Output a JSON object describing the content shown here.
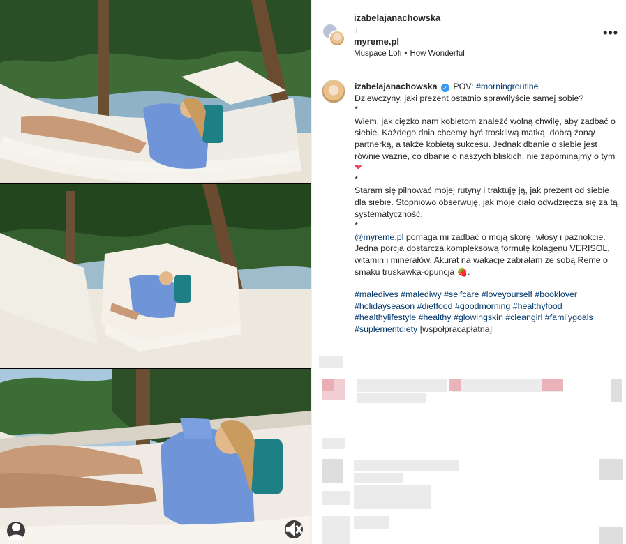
{
  "header": {
    "user1": "izabelajanachowska",
    "and": "i",
    "user2": "myreme.pl",
    "audio_artist": "Muspace Lofi",
    "audio_sep": "•",
    "audio_title": "How Wonderful",
    "more_label": "•••"
  },
  "caption": {
    "username": "izabelajanachowska",
    "verified_glyph": "✓",
    "lead": "POV: ",
    "lead_tag": "#morningroutine",
    "line1": "Dziewczyny, jaki prezent ostatnio sprawiłyście samej sobie?",
    "star1": "*",
    "para1": "Wiem, jak ciężko nam kobietom znaleźć wolną chwilę, aby zadbać o siebie. Każdego dnia chcemy być troskliwą matką, dobrą żoną/ partnerką, a także kobietą sukcesu. Jednak dbanie o siebie jest równie ważne, co dbanie o naszych bliskich, nie zapominajmy o tym",
    "heart": "❤",
    "star2": "*",
    "para2": "Staram się pilnować mojej rutyny i traktuję ją, jak prezent od siebie dla siebie. Stopniowo obserwuję, jak moje ciało odwdzięcza się za tą systematyczność.",
    "star3": "*",
    "mention": "@myreme.pl",
    "para3": " pomaga mi zadbać o moją skórę, włosy i paznokcie. Jedna porcja dostarcza kompleksową formułę kolagenu VERISOL, witamin i minerałów. Akurat na wakacje zabrałam ze sobą Reme o smaku truskawka-opuncja",
    "berry": "🍓",
    "period": ".",
    "hashtags": [
      "#maledives",
      "#malediwy",
      "#selfcare",
      "#loveyourself",
      "#booklover",
      "#holidayseason",
      "#dietfood",
      "#goodmorning",
      "#healthyfood",
      "#healthylifestyle",
      "#healthy",
      "#glowingskin",
      "#cleangirl",
      "#familygoals",
      "#suplementdiety"
    ],
    "partnership": "[współpracapłatna]"
  },
  "colors": {
    "link": "#00376b",
    "verified": "#3897f0",
    "shirt": "#6f95d8",
    "pillow": "#1f7f86"
  },
  "icons": {
    "user_tag": "user-icon",
    "mute": "speaker-muted-icon",
    "more": "more-options-icon"
  }
}
